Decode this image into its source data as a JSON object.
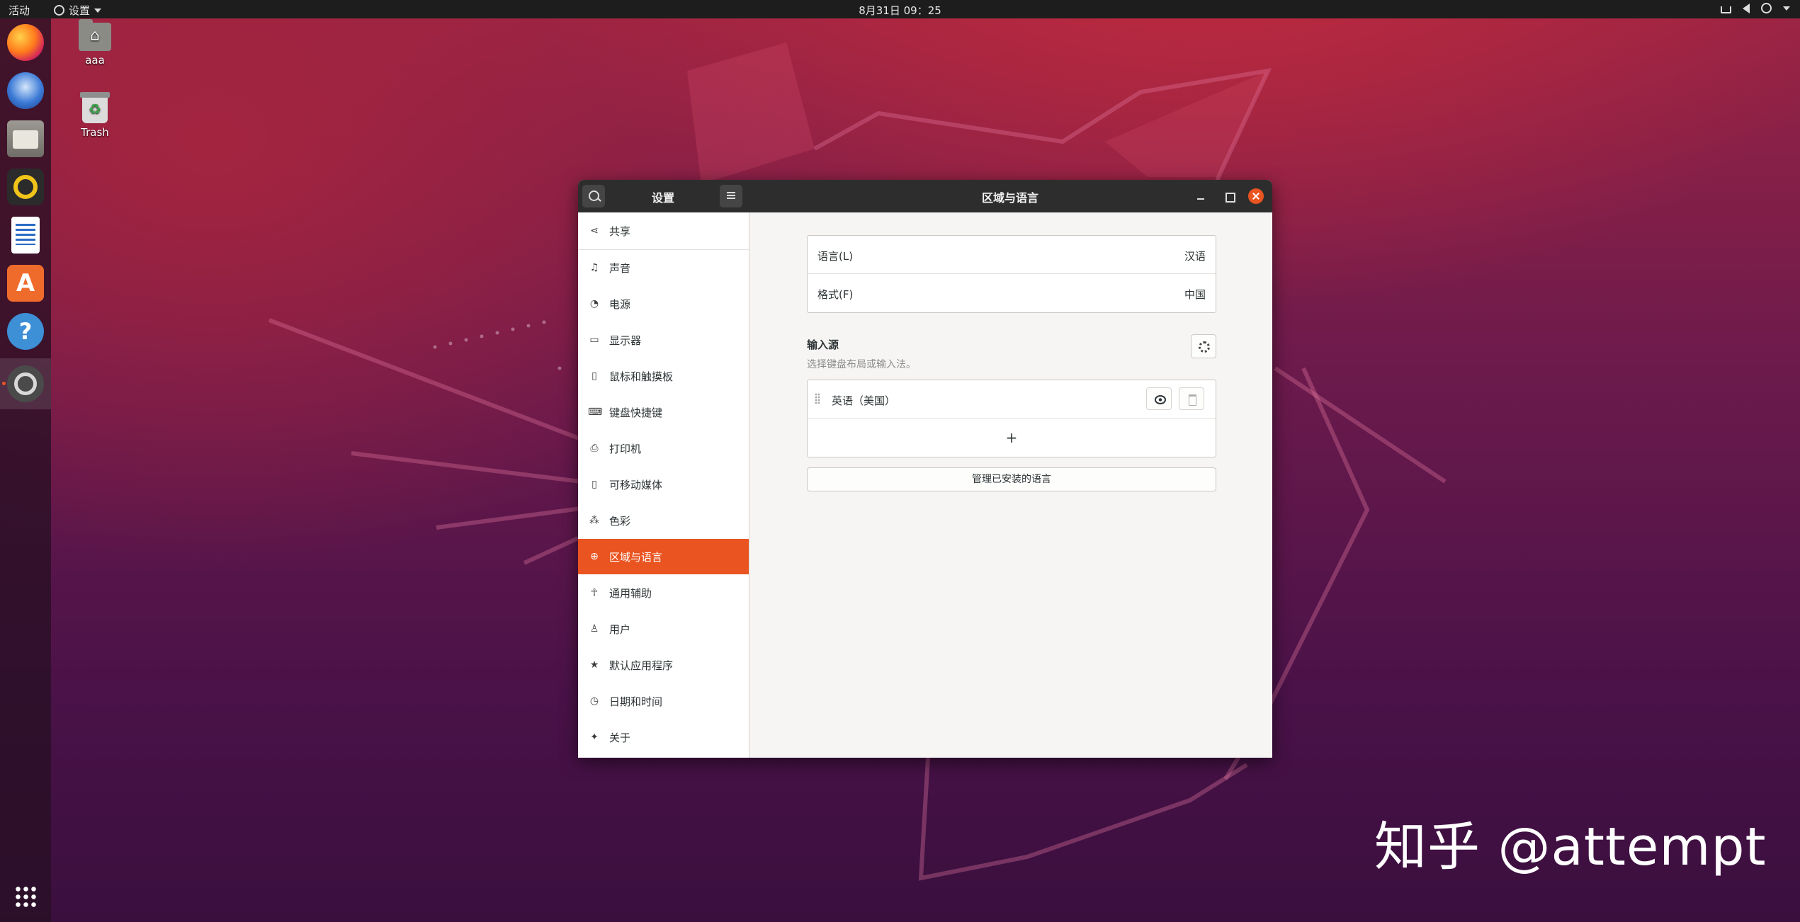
{
  "topbar": {
    "activities": "活动",
    "app_menu_label": "设置",
    "clock": "8月31日  09：25",
    "tray_icons": [
      "network-icon",
      "volume-icon",
      "power-icon"
    ]
  },
  "dock": {
    "apps": [
      "Firefox",
      "Thunderbird",
      "Files",
      "Rhythmbox",
      "LibreOffice Writer",
      "Ubuntu Software",
      "Help",
      "Settings"
    ],
    "active": "Settings"
  },
  "desktop": {
    "icons": [
      {
        "label": "aaa"
      },
      {
        "label": "Trash"
      }
    ]
  },
  "window": {
    "sidebar_title": "设置",
    "title": "区域与语言",
    "sidebar": {
      "items": [
        {
          "label": "共享",
          "icon": "share-icon"
        },
        {
          "label": "声音",
          "icon": "music-note-icon"
        },
        {
          "label": "电源",
          "icon": "power-icon"
        },
        {
          "label": "显示器",
          "icon": "display-icon"
        },
        {
          "label": "鼠标和触摸板",
          "icon": "mouse-icon"
        },
        {
          "label": "键盘快捷键",
          "icon": "keyboard-icon"
        },
        {
          "label": "打印机",
          "icon": "printer-icon"
        },
        {
          "label": "可移动媒体",
          "icon": "removable-media-icon"
        },
        {
          "label": "色彩",
          "icon": "color-icon"
        },
        {
          "label": "区域与语言",
          "icon": "globe-icon"
        },
        {
          "label": "通用辅助",
          "icon": "accessibility-icon"
        },
        {
          "label": "用户",
          "icon": "user-icon"
        },
        {
          "label": "默认应用程序",
          "icon": "star-icon"
        },
        {
          "label": "日期和时间",
          "icon": "clock-icon"
        },
        {
          "label": "关于",
          "icon": "sparkle-icon"
        }
      ],
      "active_index": 9
    },
    "content": {
      "language_label": "语言(L)",
      "language_value": "汉语",
      "formats_label": "格式(F)",
      "formats_value": "中国",
      "input_sources_title": "输入源",
      "input_sources_subtitle": "选择键盘布局或输入法。",
      "input_sources": [
        {
          "label": "英语（美国）"
        }
      ],
      "add_label": "+",
      "manage_button": "管理已安装的语言"
    }
  },
  "watermark": "知乎 @attempt",
  "colors": {
    "accent": "#e95420",
    "annotation_arrow": "#e8212a",
    "titlebar": "#2d2d2d"
  }
}
